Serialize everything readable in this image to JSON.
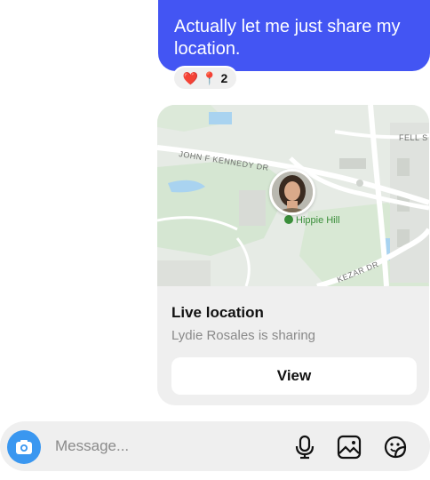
{
  "message": {
    "text": "Actually let me just share my location."
  },
  "reactions": {
    "icons": [
      "heart-emoji",
      "pin-emoji"
    ],
    "heart_glyph": "❤️",
    "pin_glyph": "📍",
    "count": "2"
  },
  "map": {
    "labels": {
      "road1": "JOHN F KENNEDY DR",
      "road2": "FELL S",
      "road3": "KEZAR DR",
      "place": "Hippie Hill"
    }
  },
  "live_location": {
    "title": "Live location",
    "subtitle": "Lydie Rosales is sharing",
    "view_label": "View"
  },
  "composer": {
    "placeholder": "Message...",
    "icons": [
      "camera-icon",
      "microphone-icon",
      "gallery-icon",
      "sticker-icon"
    ]
  },
  "colors": {
    "bubble": "#4355f3",
    "camera": "#3a97f0",
    "card": "#efefef"
  }
}
